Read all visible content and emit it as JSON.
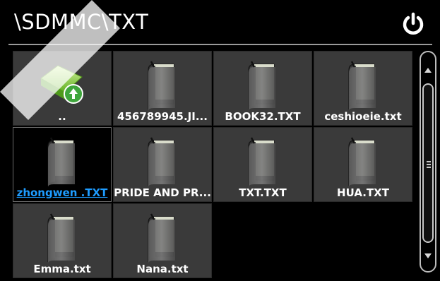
{
  "header": {
    "path": "\\SDMMC\\TXT"
  },
  "icons": {
    "power": "power-icon",
    "folder_up": "folder-up-icon",
    "book": "book-icon"
  },
  "colors": {
    "selected_label": "#1e9cff",
    "tile_bg": "#3a3a3a"
  },
  "files": [
    {
      "name": "..",
      "type": "up"
    },
    {
      "name": "456789945.JI...",
      "type": "file"
    },
    {
      "name": "BOOK32.TXT",
      "type": "file"
    },
    {
      "name": "ceshioeie.txt",
      "type": "file"
    },
    {
      "name": "zhongwen .TXT",
      "type": "file",
      "selected": true
    },
    {
      "name": "PRIDE AND PR...",
      "type": "file"
    },
    {
      "name": "TXT.TXT",
      "type": "file"
    },
    {
      "name": "HUA.TXT",
      "type": "file"
    },
    {
      "name": "Emma.txt",
      "type": "file"
    },
    {
      "name": "Nana.txt",
      "type": "file"
    }
  ]
}
